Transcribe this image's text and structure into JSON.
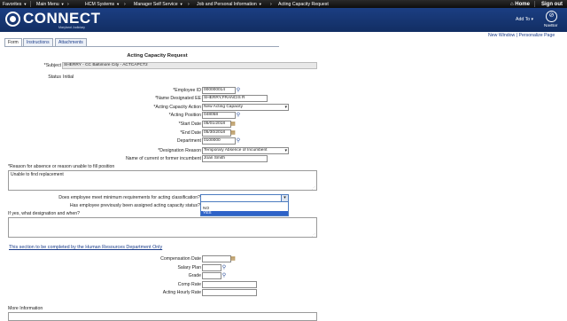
{
  "menubar": {
    "items": [
      "Favorites",
      "Main Menu",
      "HCM Systems",
      "Manager Self Service",
      "Job and Personal Information",
      "Acting Capacity Request"
    ],
    "home": "Home",
    "signout": "Sign out"
  },
  "banner": {
    "brand": "CONNECT",
    "subtitle": "Maryland Judiciary",
    "add_to": "Add To",
    "navbar": "NavBar"
  },
  "links": {
    "new_window": "New Window",
    "separator": "|",
    "personalize": "Personalize Page"
  },
  "tabs": [
    "Form",
    "Instructions",
    "Attachments"
  ],
  "form": {
    "title": "Acting Capacity Request",
    "subject_label": "*Subject",
    "subject_value": "SHERRY - CC Baltimore City - ACTCAPCT2",
    "status_label": "Status",
    "status_value": "Initial",
    "employee_id_label": "*Employee ID",
    "employee_id_value": "000000014",
    "name_designated_label": "*Name Designated EE",
    "name_designated_value": "SHERRY,FRANCIS R",
    "action_label": "*Acting Capacity Action",
    "action_value": "New Acting Capacity",
    "position_label": "*Acting Position",
    "position_value": "048058",
    "start_label": "*Start Date",
    "start_value": "05/01/2018",
    "end_label": "*End Date",
    "end_value": "05/30/2018",
    "department_label": "Department",
    "department_value": "0100000",
    "reason_label": "*Designation Reason",
    "reason_value": "Temporary Absence of Incumbent",
    "incumbent_label": "Name of current or former incumbent",
    "incumbent_value": "Joan Smith",
    "absence_label": "*Reason for absence or reason unable to fill position",
    "absence_value": "Unable to find replacement",
    "meets_label": "Does employee meet minimum requirements for acting classification?",
    "meets_options": [
      "",
      "NO",
      "YES"
    ],
    "previously_label": "Has employee previously been assigned acting capacity status?",
    "designation_when_label": "If yes, what designation and when?",
    "hr_section_link": "This section to be completed by the Human Resources Department Only",
    "comp_date_label": "Compensation Date",
    "salary_plan_label": "Salary Plan",
    "grade_label": "Grade",
    "comp_rate_label": "Comp Rate",
    "acting_rate_label": "Acting Hourly Rate",
    "more_info_label": "More Information"
  }
}
